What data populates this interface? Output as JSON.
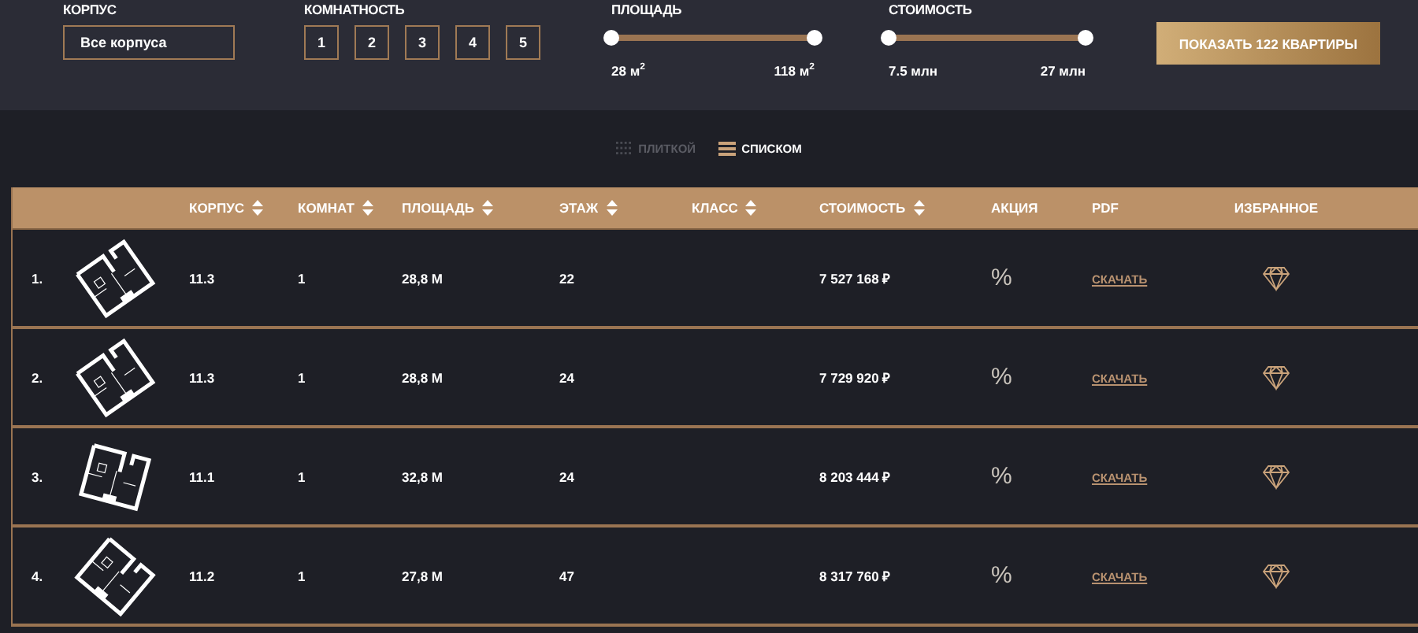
{
  "filters": {
    "building": {
      "label": "КОРПУС",
      "value": "Все корпуса"
    },
    "rooms": {
      "label": "КОМНАТНОСТЬ",
      "options": [
        {
          "label": "1",
          "selected": false
        },
        {
          "label": "2",
          "selected": false
        },
        {
          "label": "3",
          "selected": false
        },
        {
          "label": "4",
          "selected": false
        },
        {
          "label": "5",
          "selected": false
        }
      ]
    },
    "sliders": [
      {
        "label": "ПЛОЩАДЬ",
        "level": 1,
        "min": "28 м$^{2}$",
        "max": "118 м$^{2}$"
      },
      {
        "label": "СТОИМОСТЬ",
        "level": 1,
        "min": "7.5 млн",
        "max": "27 млн"
      }
    ],
    "submit": "ПОКАЗАТЬ 122 КВАРТИРЫ"
  },
  "view_toggle": [
    {
      "kind": "grid",
      "label": "ПЛИТКОЙ",
      "selected": false
    },
    {
      "kind": "list",
      "label": "СПИСКОМ",
      "selected": true
    }
  ],
  "table": {
    "columns": [
      {
        "label": "КОРПУС",
        "sortable": true
      },
      {
        "label": "КОМНАТ",
        "sortable": true
      },
      {
        "label": "ПЛОЩАДЬ",
        "sortable": true
      },
      {
        "label": "ЭТАЖ",
        "sortable": true
      },
      {
        "label": "КЛАСС",
        "sortable": true
      },
      {
        "label": "СТОИМОСТЬ",
        "sortable": true
      },
      {
        "label": "АКЦИЯ",
        "sortable": false
      },
      {
        "label": "PDF",
        "sortable": false
      },
      {
        "label": "ИЗБРАННОЕ",
        "sortable": false
      }
    ],
    "rows": [
      {
        "number": "1.",
        "building": "11.3",
        "rooms": "1",
        "area": "28,8 М",
        "floor": "22",
        "price": "7 527 168 ₽",
        "promo": "%",
        "pdf": "СКАЧАТЬ"
      },
      {
        "number": "2.",
        "building": "11.3",
        "rooms": "1",
        "area": "28,8 М",
        "floor": "24",
        "price": "7 729 920 ₽",
        "promo": "%",
        "pdf": "СКАЧАТЬ"
      },
      {
        "number": "3.",
        "building": "11.1",
        "rooms": "1",
        "area": "32,8 М",
        "floor": "24",
        "price": "8 203 444 ₽",
        "promo": "%",
        "pdf": "СКАЧАТЬ"
      },
      {
        "number": "4.",
        "building": "11.2",
        "rooms": "1",
        "area": "27,8 М",
        "floor": "47",
        "price": "8 317 760 ₽",
        "promo": "%",
        "pdf": "СКАЧАТЬ"
      }
    ]
  }
}
